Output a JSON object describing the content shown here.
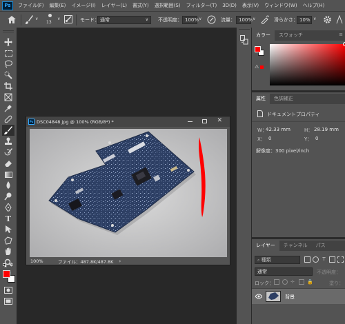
{
  "app_logo": "Ps",
  "menu": [
    "ファイル(F)",
    "編集(E)",
    "イメージ(I)",
    "レイヤー(L)",
    "書式(Y)",
    "選択範囲(S)",
    "フィルター(T)",
    "3D(D)",
    "表示(V)",
    "ウィンドウ(W)",
    "ヘルプ(H)"
  ],
  "options": {
    "brush_size": "13",
    "mode_label": "モード：",
    "mode_value": "通常",
    "opacity_label": "不透明度：",
    "opacity_value": "100%",
    "flow_label": "流量：",
    "flow_value": "100%",
    "smoothing_label": "滑らかさ：",
    "smoothing_value": "10%"
  },
  "document": {
    "title": "DSC04848.jpg @ 100% (RGB/8*) *",
    "zoom": "100%",
    "file_info": "ファイル：487.8K/487.8K"
  },
  "color_panel": {
    "tabs": [
      "カラー",
      "スウォッチ"
    ],
    "foreground": "#ff0000",
    "background": "#ffffff"
  },
  "properties_panel": {
    "tabs": [
      "属性",
      "色調補正"
    ],
    "doc_props_label": "ドキュメントプロパティ",
    "w_label": "W：",
    "w_value": "42.33 mm",
    "h_label": "H：",
    "h_value": "28.19 mm",
    "x_label": "X：",
    "x_value": "0",
    "y_label": "Y：",
    "y_value": "0",
    "resolution": "解像度：300 pixel/inch"
  },
  "layers_panel": {
    "tabs": [
      "レイヤー",
      "チャンネル",
      "パス"
    ],
    "filter_placeholder": "種類",
    "blend_mode": "通常",
    "opacity_label": "不透明度：",
    "lock_label": "ロック：",
    "fill_label": "塗り：",
    "layer_name": "背景"
  }
}
